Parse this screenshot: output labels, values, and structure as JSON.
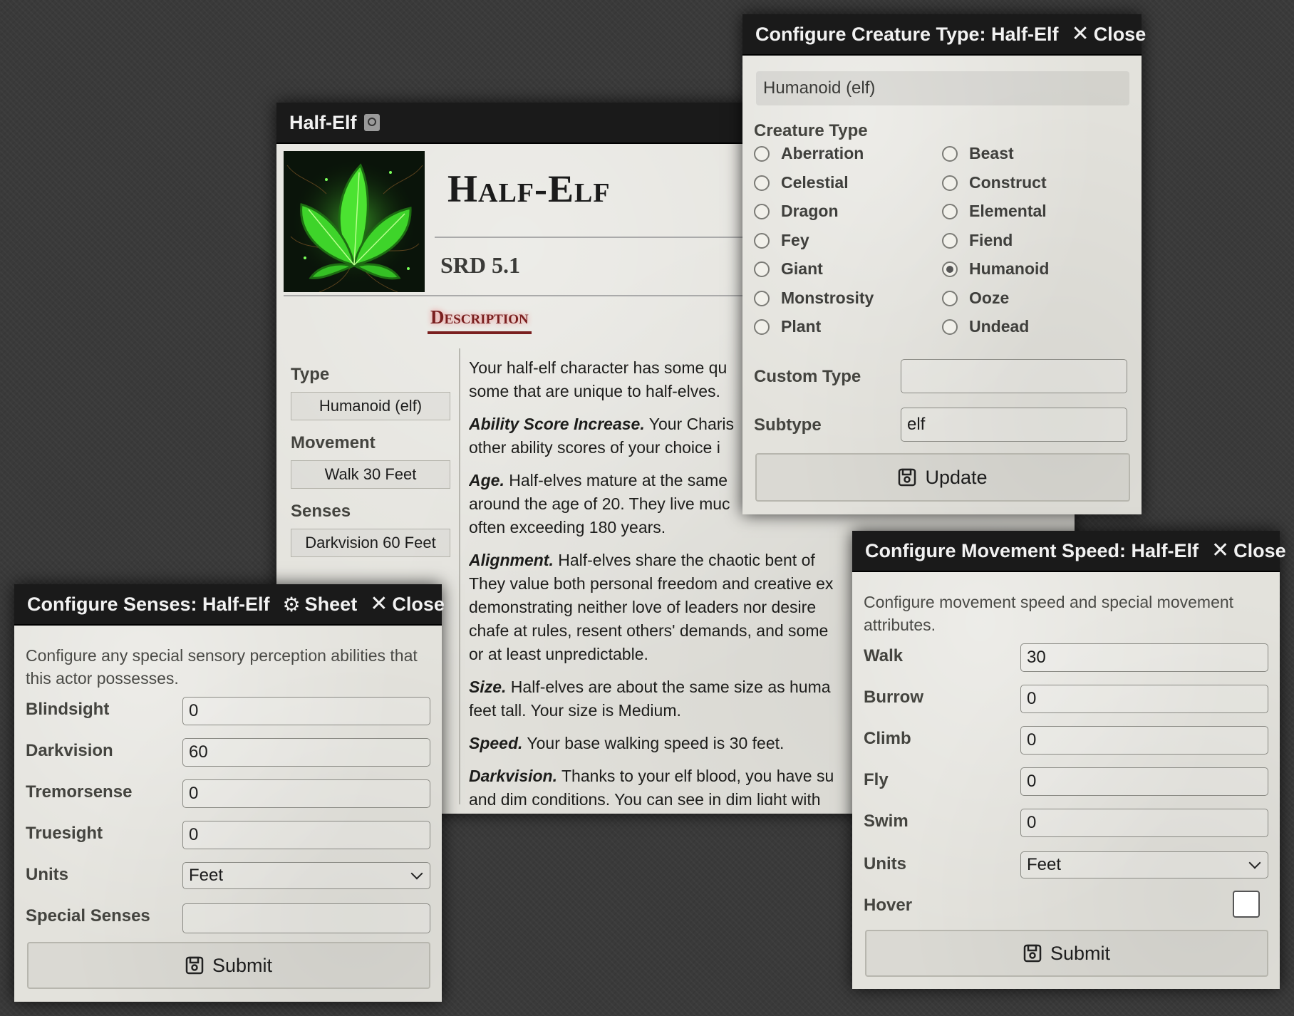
{
  "sheet": {
    "title": "Half-Elf",
    "name": "Half-Elf",
    "source": "SRD 5.1",
    "tab": "Description",
    "type_label": "Type",
    "type_value": "Humanoid (elf)",
    "movement_label": "Movement",
    "movement_value": "Walk 30 Feet",
    "senses_label": "Senses",
    "senses_value": "Darkvision 60 Feet",
    "description": [
      {
        "bold": "",
        "text": "Your half-elf character has some qu"
      },
      {
        "bold": "",
        "text": "some that are unique to half-elves."
      },
      {
        "bold": "Ability Score Increase.",
        "text": " Your Charis"
      },
      {
        "bold": "",
        "text": "other ability scores of your choice i"
      },
      {
        "bold": "Age.",
        "text": " Half-elves mature at the same"
      },
      {
        "bold": "",
        "text": "around the age of 20. They live muc"
      },
      {
        "bold": "",
        "text": "often exceeding 180 years."
      },
      {
        "bold": "Alignment.",
        "text": " Half-elves share the chaotic bent of"
      },
      {
        "bold": "",
        "text": "They value both personal freedom and creative ex"
      },
      {
        "bold": "",
        "text": "demonstrating neither love of leaders nor desire"
      },
      {
        "bold": "",
        "text": "chafe at rules, resent others' demands, and some"
      },
      {
        "bold": "",
        "text": "or at least unpredictable."
      },
      {
        "bold": "Size.",
        "text": " Half-elves are about the same size as huma"
      },
      {
        "bold": "",
        "text": "feet tall. Your size is Medium."
      },
      {
        "bold": "Speed.",
        "text": " Your base walking speed is 30 feet."
      },
      {
        "bold": "Darkvision.",
        "text": " Thanks to your elf blood, you have su"
      },
      {
        "bold": "",
        "text": "and dim conditions. You can see in dim light with"
      }
    ]
  },
  "creature_type": {
    "title": "Configure Creature Type: Half-Elf",
    "close_label": "Close",
    "summary": "Humanoid (elf)",
    "section_label": "Creature Type",
    "options_left": [
      "Aberration",
      "Celestial",
      "Dragon",
      "Fey",
      "Giant",
      "Monstrosity",
      "Plant"
    ],
    "options_right": [
      "Beast",
      "Construct",
      "Elemental",
      "Fiend",
      "Humanoid",
      "Ooze",
      "Undead"
    ],
    "selected": "Humanoid",
    "custom_type_label": "Custom Type",
    "custom_type_value": "",
    "subtype_label": "Subtype",
    "subtype_value": "elf",
    "update_label": "Update"
  },
  "senses": {
    "title": "Configure Senses: Half-Elf",
    "sheet_label": "Sheet",
    "close_label": "Close",
    "hint": "Configure any special sensory perception abilities that this actor possesses.",
    "fields": [
      {
        "label": "Blindsight",
        "value": "0"
      },
      {
        "label": "Darkvision",
        "value": "60"
      },
      {
        "label": "Tremorsense",
        "value": "0"
      },
      {
        "label": "Truesight",
        "value": "0"
      }
    ],
    "units_label": "Units",
    "units_value": "Feet",
    "special_label": "Special Senses",
    "special_value": "",
    "submit_label": "Submit"
  },
  "movement": {
    "title": "Configure Movement Speed: Half-Elf",
    "close_label": "Close",
    "hint": "Configure movement speed and special movement attributes.",
    "fields": [
      {
        "label": "Walk",
        "value": "30"
      },
      {
        "label": "Burrow",
        "value": "0"
      },
      {
        "label": "Climb",
        "value": "0"
      },
      {
        "label": "Fly",
        "value": "0"
      },
      {
        "label": "Swim",
        "value": "0"
      }
    ],
    "units_label": "Units",
    "units_value": "Feet",
    "hover_label": "Hover",
    "hover_checked": false,
    "submit_label": "Submit"
  }
}
